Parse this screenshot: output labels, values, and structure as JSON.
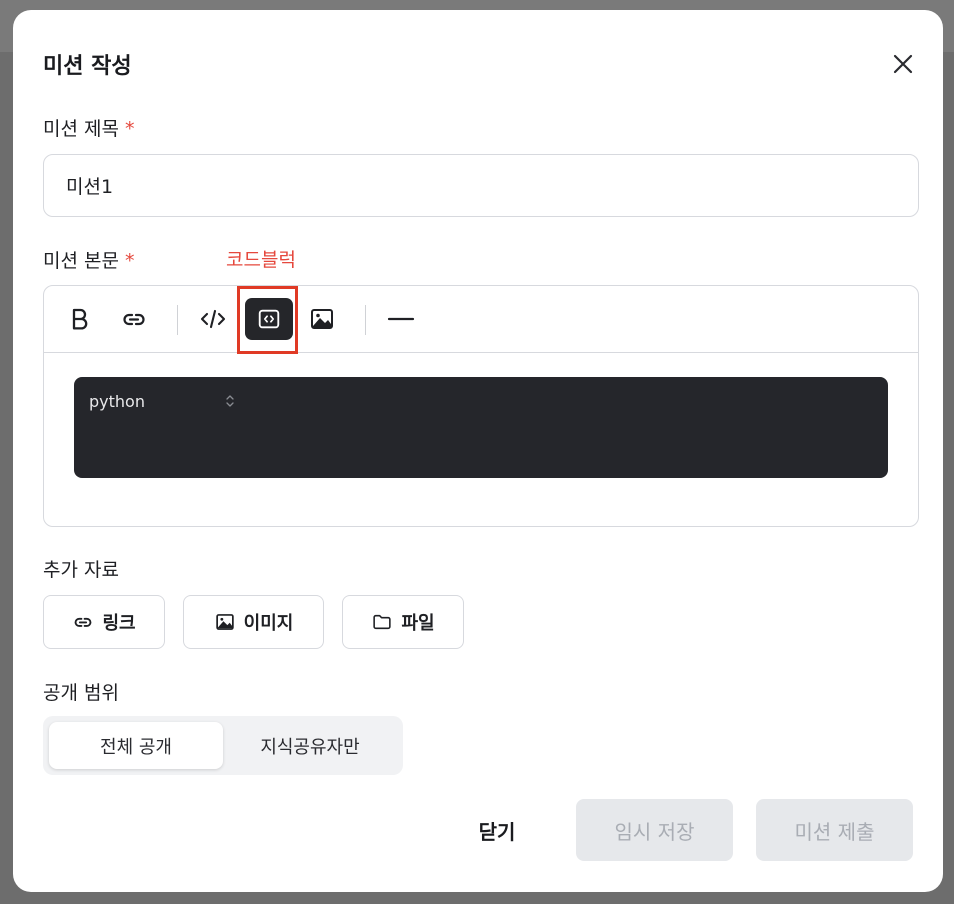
{
  "modal": {
    "title": "미션 작성",
    "close_icon": "close-icon"
  },
  "form": {
    "title_label": "미션 제목",
    "required_mark": "*",
    "title_value": "미션1",
    "body_label": "미션 본문",
    "annotation": "코드블럭"
  },
  "toolbar": {
    "items": [
      {
        "icon": "bold-icon"
      },
      {
        "icon": "link-icon"
      },
      {
        "icon": "inline-code-icon"
      },
      {
        "icon": "code-block-icon",
        "active": true
      },
      {
        "icon": "image-icon"
      },
      {
        "icon": "horizontal-rule-icon"
      }
    ]
  },
  "code_block": {
    "language": "python"
  },
  "attachments": {
    "label": "추가 자료",
    "buttons": [
      {
        "label": "링크",
        "icon": "link-icon"
      },
      {
        "label": "이미지",
        "icon": "image-icon"
      },
      {
        "label": "파일",
        "icon": "folder-icon"
      }
    ]
  },
  "visibility": {
    "label": "공개 범위",
    "options": [
      {
        "label": "전체 공개",
        "selected": true
      },
      {
        "label": "지식공유자만",
        "selected": false
      }
    ]
  },
  "footer": {
    "close_label": "닫기",
    "draft_label": "임시 저장",
    "submit_label": "미션 제출"
  },
  "colors": {
    "required": "#e5483d",
    "annotation": "#e03a25",
    "code_bg": "#25262b",
    "disabled_bg": "#e6e8eb"
  }
}
